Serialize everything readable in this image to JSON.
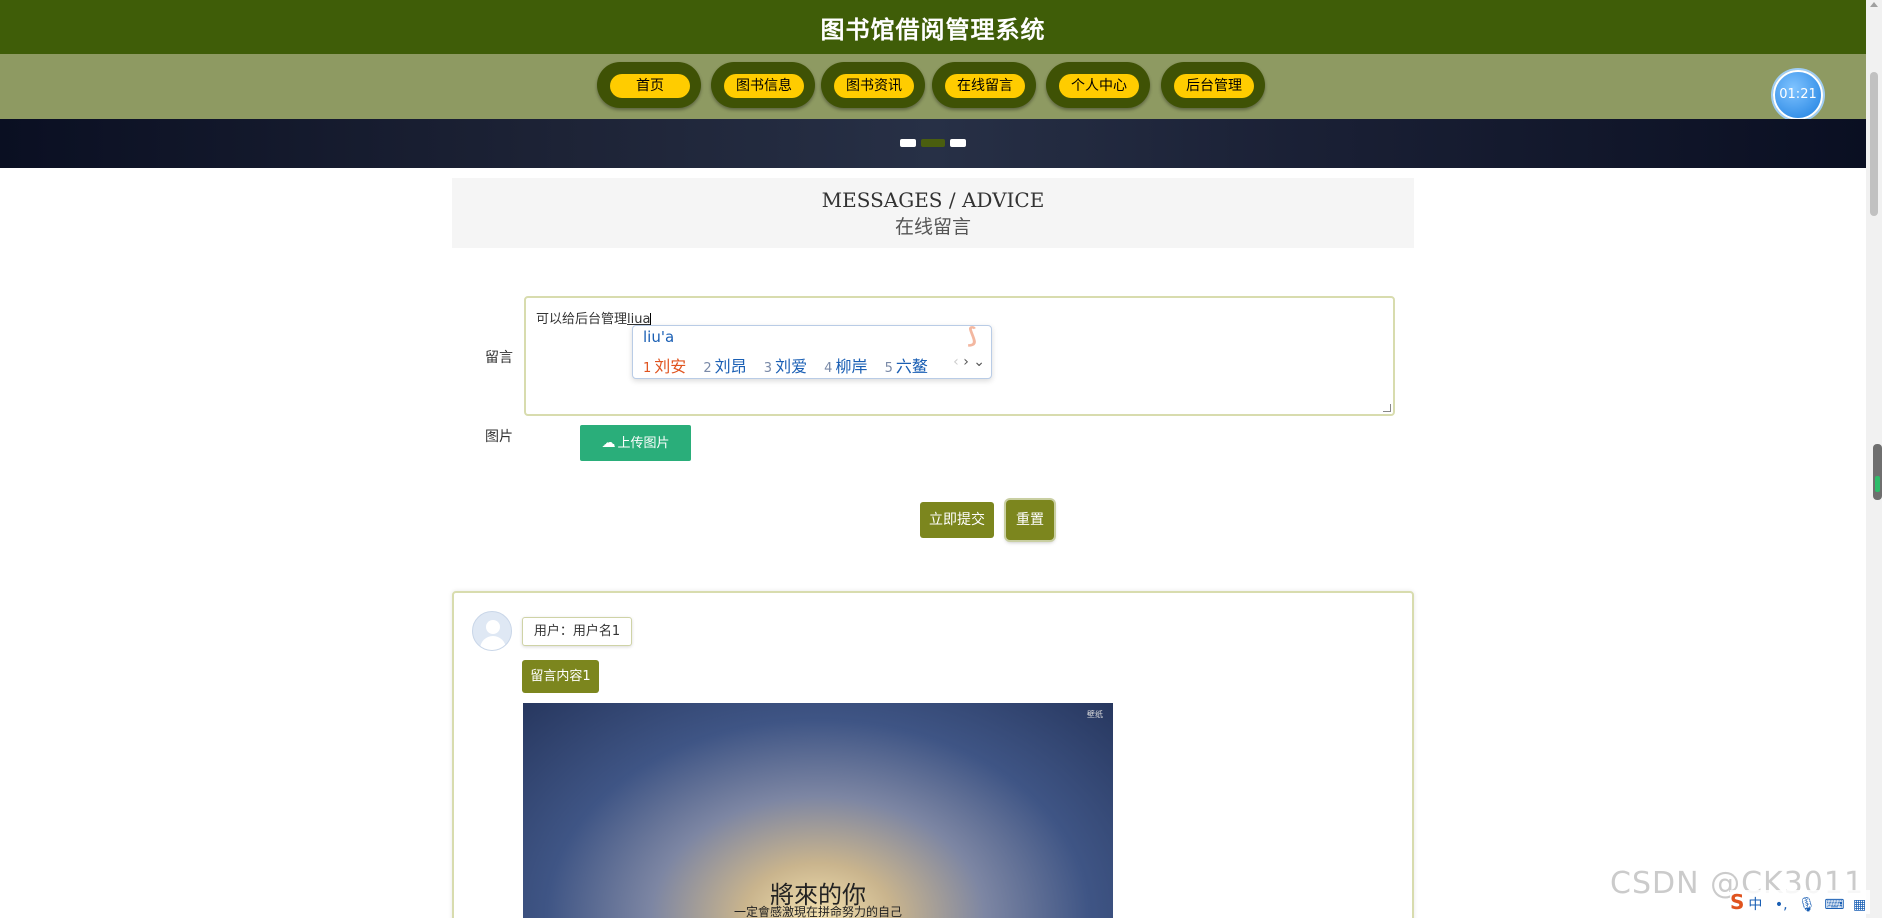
{
  "site": {
    "title": "图书馆借阅管理系统"
  },
  "nav": {
    "items": [
      {
        "label": "首页"
      },
      {
        "label": "图书信息"
      },
      {
        "label": "图书资讯"
      },
      {
        "label": "在线留言"
      },
      {
        "label": "个人中心"
      },
      {
        "label": "后台管理"
      }
    ]
  },
  "timer": {
    "text": "01:21"
  },
  "carousel": {
    "slides": 3,
    "active_index": 1
  },
  "section": {
    "title_en": "MESSAGES / ADVICE",
    "title_cn": "在线留言"
  },
  "form": {
    "message_label": "留言",
    "message_value": "可以给后台管理",
    "message_composing": "liua",
    "image_label": "图片",
    "upload_label": "上传图片",
    "submit_label": "立即提交",
    "reset_label": "重置"
  },
  "ime": {
    "pinyin": "liu'a",
    "candidates": [
      {
        "n": "1",
        "text": "刘安"
      },
      {
        "n": "2",
        "text": "刘昂"
      },
      {
        "n": "3",
        "text": "刘爱"
      },
      {
        "n": "4",
        "text": "柳岸"
      },
      {
        "n": "5",
        "text": "六鳌"
      }
    ],
    "tray_mode": "中"
  },
  "message": {
    "user_label": "用户：用户名1",
    "content_label": "留言内容1",
    "image_title": "將來的你",
    "image_subtitle": "一定會感激現在拼命努力的自己",
    "image_corner": "壁纸"
  },
  "watermark": "CSDN @CK3011",
  "colors": {
    "header_bg": "#3f5d08",
    "nav_bg": "#8e9a62",
    "nav_pill": "#ffcc00",
    "olive_button": "#7c861e",
    "upload_button": "#2aae7a"
  }
}
